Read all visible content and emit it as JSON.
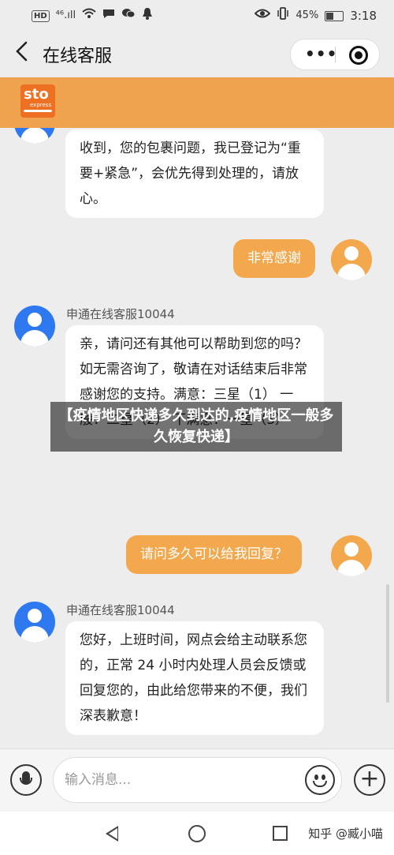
{
  "status_bar": {
    "network_badge": "HD",
    "signal": "⁴⁶.ıll",
    "time": "3:18",
    "battery_percent": "45%",
    "battery_level": 0.45,
    "left_icons": [
      "hd-badge",
      "signal-icon",
      "wifi-icon",
      "message-icon",
      "wechat-icon",
      "notification-icon"
    ],
    "right_icons": [
      "eye-icon",
      "vibrate-icon",
      "battery-icon"
    ]
  },
  "header": {
    "title": "在线客服",
    "back_icon": "chevron-left-icon",
    "more_label": "•••"
  },
  "banner": {
    "brand_color": "#f0a34e",
    "logo_text": "sto",
    "logo_subtext": "express"
  },
  "messages": [
    {
      "side": "left",
      "sender": "",
      "text": "收到，您的包裹问题，我已登记为“重要+紧急”，会优先得到处理的，请放心。"
    },
    {
      "side": "right",
      "text": "非常感谢"
    },
    {
      "side": "left",
      "sender": "申通在线客服10044",
      "text": "亲，请问还有其他可以帮助到您的吗？如无需咨询了，敬请在对话结束后非常感谢您的支持。满意：三星（1） 一般：二星（2） 不满意：一星（3）"
    },
    {
      "side": "right",
      "text": "请问多久可以给我回复？"
    },
    {
      "side": "left",
      "sender": "申通在线客服10044",
      "text": "您好，上班时间，网点会给主动联系您的，正常 24 小时内处理人员会反馈或回复您的，由此给您带来的不便，我们深表歉意！"
    }
  ],
  "overlay_caption": "【疫情地区快递多久到达的,疫情地区一般多久恢复快递】",
  "input_bar": {
    "placeholder": "输入消息...",
    "voice_icon": "microphone-icon",
    "emoji_icon": "smile-icon",
    "plus_label": "+"
  },
  "watermark": "知乎 @臧小喵",
  "colors": {
    "agent_avatar": "#2f79f0",
    "user_bubble": "#f3a84e",
    "background": "#ededed"
  }
}
